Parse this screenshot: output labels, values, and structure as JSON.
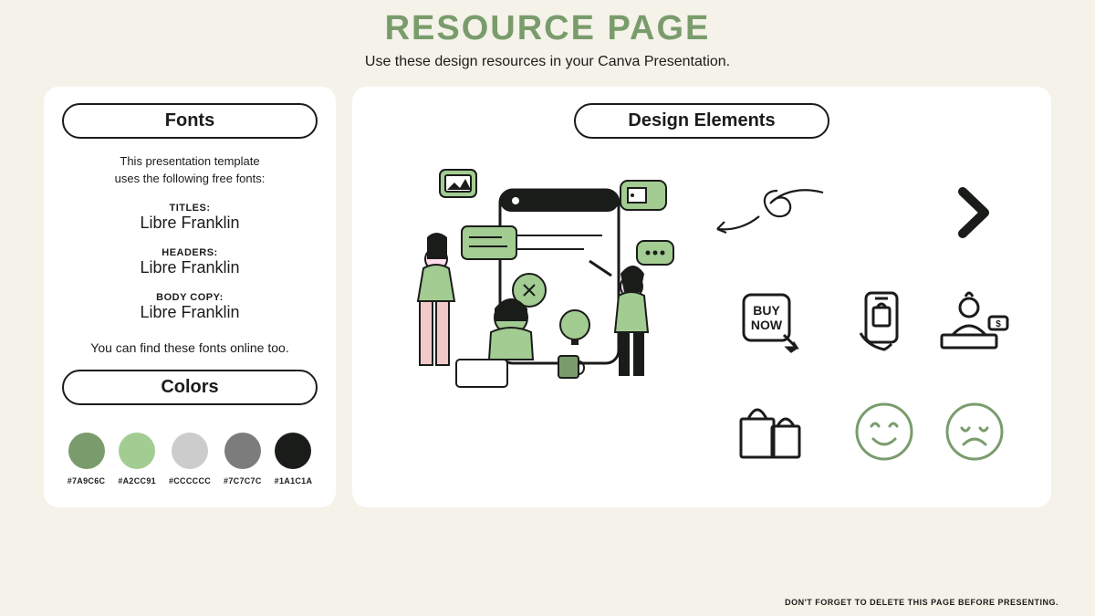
{
  "header": {
    "title": "RESOURCE PAGE",
    "subtitle": "Use these design resources in your Canva Presentation."
  },
  "fonts": {
    "heading": "Fonts",
    "intro_line1": "This presentation template",
    "intro_line2": "uses the following free fonts:",
    "titles_label": "TITLES:",
    "titles_font": "Libre Franklin",
    "headers_label": "HEADERS:",
    "headers_font": "Libre Franklin",
    "body_label": "BODY COPY:",
    "body_font": "Libre Franklin",
    "note": "You can find these fonts online too."
  },
  "colors": {
    "heading": "Colors",
    "swatches": [
      {
        "hex": "#7A9C6C"
      },
      {
        "hex": "#A2CC91"
      },
      {
        "hex": "#CCCCCC"
      },
      {
        "hex": "#7C7C7C"
      },
      {
        "hex": "#1A1C1A"
      }
    ]
  },
  "elements": {
    "heading": "Design Elements"
  },
  "footer": "DON'T FORGET TO DELETE THIS PAGE BEFORE PRESENTING."
}
